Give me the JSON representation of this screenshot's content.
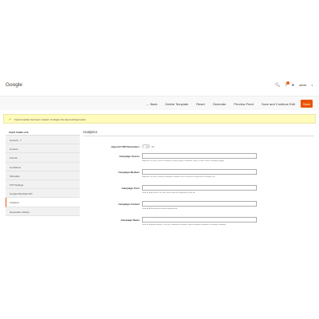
{
  "header": {
    "title": "Google",
    "user_name": "admin",
    "notification_count": "1"
  },
  "toolbar": {
    "back": "← Back",
    "delete": "Delete Template",
    "reset": "Reset",
    "generate": "Generate",
    "preview": "Preview Feed",
    "save_continue": "Save and Continue Edit",
    "save": "Save"
  },
  "message": {
    "text": "Feed template has been created. Configure the feed settings below."
  },
  "sidebar": {
    "heading": "FEED TEMPLATE",
    "items": [
      {
        "label": "General"
      },
      {
        "label": "Content"
      },
      {
        "label": "Format"
      },
      {
        "label": "Conditions"
      },
      {
        "label": "Schedule"
      },
      {
        "label": "FTP Settings"
      },
      {
        "label": "Google Merchant API"
      },
      {
        "label": "Analytics"
      },
      {
        "label": "Generation History"
      }
    ]
  },
  "analytics": {
    "section_title": "Analytics",
    "append_label": "Append UTM Parameters",
    "append_value": "No",
    "fields": [
      {
        "label": "Campaign Source",
        "value": "",
        "note": "Required. Use utm_source to identify a search engine, newsletter name, or other source. Example: google"
      },
      {
        "label": "Campaign Medium",
        "value": "",
        "note": "Required. Use utm_medium to identify a medium such as email or cost-per-click. Example: cpc"
      },
      {
        "label": "Campaign Term",
        "value": "",
        "note": "Used for paid search. Use utm_term to note the keywords for this ad."
      },
      {
        "label": "Campaign Content",
        "value": "",
        "note": "Used for A/B testing and content-targeted ads."
      },
      {
        "label": "Campaign Name",
        "value": "",
        "note": "Used for keyword analysis. Use utm_campaign to identify a specific product promotion or strategic campaign."
      }
    ]
  }
}
